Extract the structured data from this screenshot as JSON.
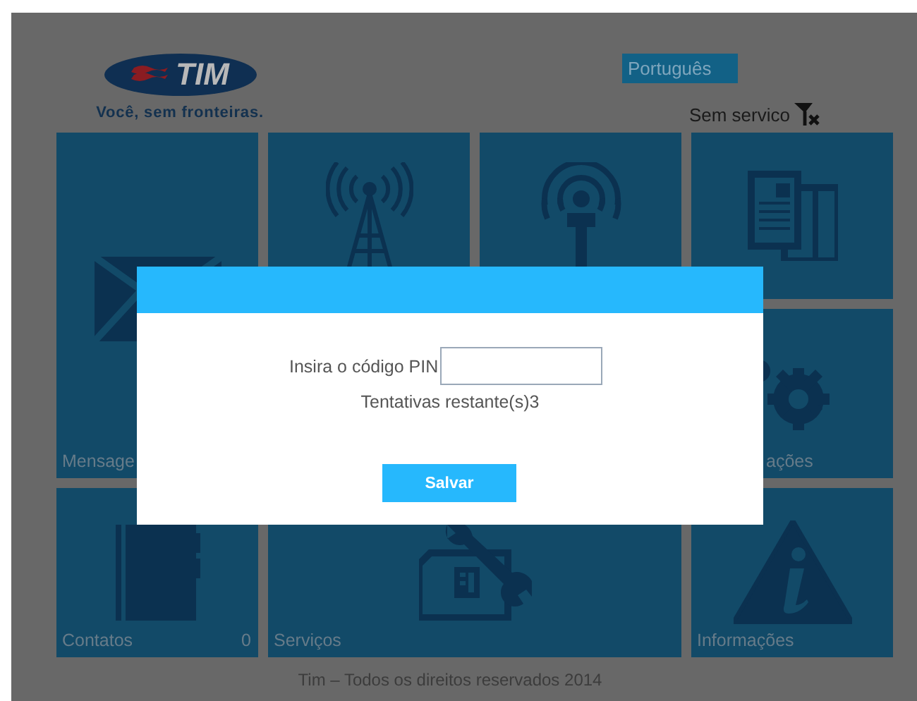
{
  "header": {
    "logo_text": "TIM",
    "tagline": "Você, sem fronteiras.",
    "language": "Português",
    "network_status": "Sem servico"
  },
  "tiles": [
    {
      "kind": "messages",
      "label": "Mensage"
    },
    {
      "kind": "tower"
    },
    {
      "kind": "podcast"
    },
    {
      "kind": "documents"
    },
    {
      "kind": "settings",
      "label": "ações"
    },
    {
      "kind": "contacts",
      "label": "Contatos",
      "count": "0"
    },
    {
      "kind": "services",
      "label": "Serviços"
    },
    {
      "kind": "info",
      "label": "Informações"
    }
  ],
  "footer": "Tim – Todos os direitos reservados 2014",
  "pin_dialog": {
    "label": "Insira o código PIN",
    "attempts": "Tentativas restante(s)3",
    "button": "Salvar"
  }
}
